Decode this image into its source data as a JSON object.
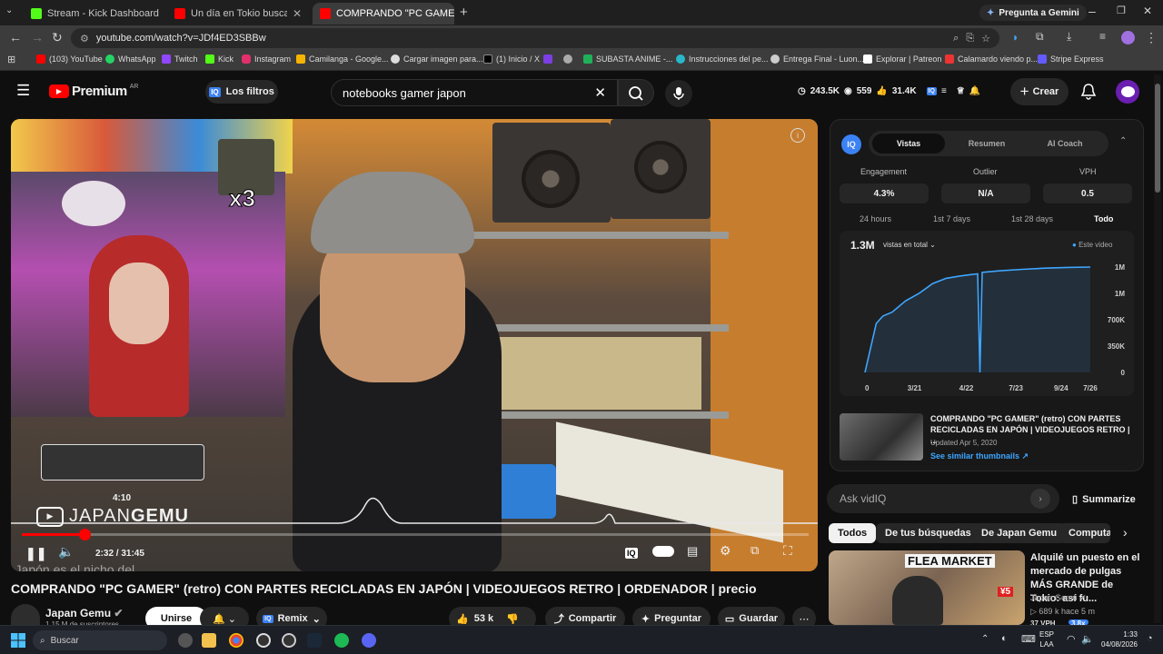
{
  "browser": {
    "tabs": [
      {
        "title": "Stream - Kick Dashboard",
        "color": "#53fc18"
      },
      {
        "title": "Un día en Tokio buscando JOYA",
        "color": "#ff0000"
      },
      {
        "title": "COMPRANDO \"PC GAMER\"",
        "color": "#ff0000"
      }
    ],
    "gemini_button": "Pregunta a Gemini",
    "url": "youtube.com/watch?v=JDf4ED3SBBw",
    "bookmarks": [
      "(103) YouTube",
      "WhatsApp",
      "Twitch",
      "Kick",
      "Instagram",
      "Camilanga - Google...",
      "Cargar imagen para...",
      "(1) Inicio / X",
      "",
      "SUBASTA ANIME -...",
      "Instrucciones del pe...",
      "Entrega Final - Luon...",
      "Explorar | Patreon",
      "Calamardo viendo p...",
      "Stripe Express"
    ]
  },
  "header": {
    "logo": "Premium",
    "logo_region": "AR",
    "filters_label": "Los filtros",
    "search_value": "notebooks gamer japon",
    "stats": {
      "views": "243.5K",
      "watching": "559",
      "likes": "31.4K"
    },
    "create_label": "Crear"
  },
  "player": {
    "channel_overlay": "JAPANGEMU",
    "channel_overlay_a": "JAPAN",
    "channel_overlay_b": "GEMU",
    "preview_time": "4:10",
    "time": "2:32 / 31:45",
    "progress": 0.08,
    "subtitle": "¿Japón es el nicho del",
    "sticker_text": "x3"
  },
  "video": {
    "title": "COMPRANDO \"PC GAMER\" (retro) CON PARTES RECICLADAS EN JAPÓN | VIDEOJUEGOS RETRO | ORDENADOR | precio",
    "channel": "Japan Gemu",
    "subscribers": "1,15 M de suscriptores",
    "join_label": "Unirse",
    "remix_label": "Remix",
    "likes": "53 k",
    "share_label": "Compartir",
    "ask_label": "Preguntar",
    "save_label": "Guardar"
  },
  "iq_panel": {
    "badge": "IQ",
    "tabs": [
      "Vistas",
      "Resumen",
      "AI Coach"
    ],
    "metrics": [
      {
        "label": "Engagement",
        "value": "4.3%"
      },
      {
        "label": "Outlier",
        "value": "N/A"
      },
      {
        "label": "VPH",
        "value": "0.5"
      }
    ],
    "ranges": [
      "24 hours",
      "1st 7 days",
      "1st 28 days",
      "Todo"
    ],
    "total": "1.3M",
    "total_label": "vistas en total",
    "legend": "Este video",
    "related_title": "COMPRANDO \"PC GAMER\" (retro) CON PARTES RECICLADAS EN JAPÓN | VIDEOJUEGOS RETRO | ...",
    "related_date": "Updated Apr 5, 2020",
    "related_link": "See similar thumbnails ↗"
  },
  "chart_data": {
    "type": "line",
    "title": "",
    "x_ticks": [
      "0",
      "3/21",
      "4/22",
      "7/23",
      "9/24",
      "7/26"
    ],
    "y_ticks": [
      "0",
      "350K",
      "700K",
      "1M",
      "1M"
    ],
    "ylim": [
      0,
      1400000
    ],
    "series": [
      {
        "name": "Este video",
        "x": [
          0,
          0.05,
          0.08,
          0.12,
          0.18,
          0.24,
          0.3,
          0.36,
          0.42,
          0.47,
          0.5,
          0.51,
          0.52,
          0.6,
          0.7,
          0.8,
          0.9,
          1.0
        ],
        "values": [
          0,
          650000,
          750000,
          800000,
          950000,
          1050000,
          1180000,
          1250000,
          1280000,
          1300000,
          1310000,
          0,
          1330000,
          1350000,
          1370000,
          1385000,
          1395000,
          1400000
        ]
      }
    ],
    "grid": false
  },
  "ask": {
    "placeholder": "Ask vidIQ",
    "summarize": "Summarize"
  },
  "chips": [
    "Todos",
    "De tus búsquedas",
    "De Japan Gemu",
    "Computa"
  ],
  "recommended": {
    "title": "Alquilé un puesto en el mercado de pulgas MÁS GRANDE de Tokio: así fu...",
    "channel": "Japan Gemu",
    "meta": "▷ 689 k  hace 5 m",
    "vph": "37 VPH",
    "badge": "3.8x",
    "thumb_label": "FLEA MARKET",
    "price": "¥5"
  },
  "taskbar": {
    "search_placeholder": "Buscar",
    "lang": "ESP",
    "lang2": "LAA",
    "time": "1:33",
    "date": "04/08/2026"
  },
  "colors": {
    "accent": "#3ea6ff",
    "red": "#ff0000",
    "chart_line": "#3ea6ff"
  }
}
